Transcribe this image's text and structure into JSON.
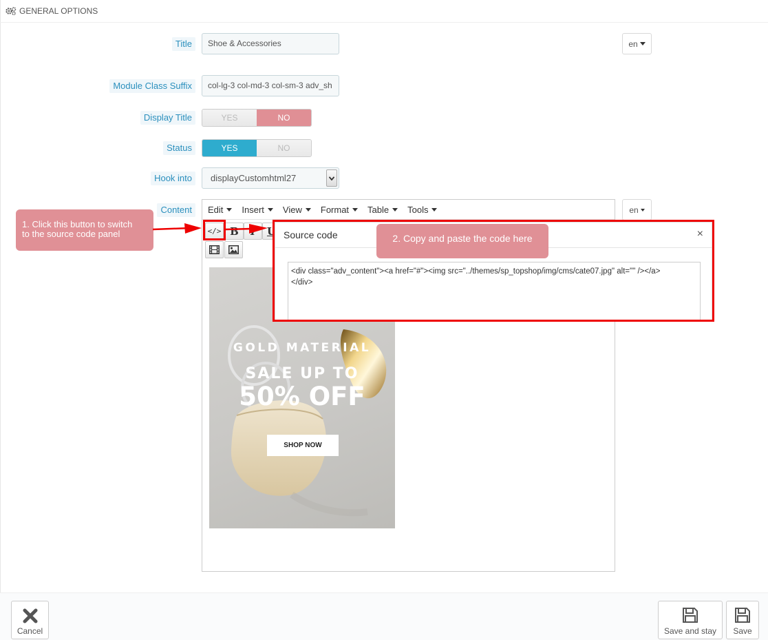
{
  "panel": {
    "heading": "GENERAL OPTIONS"
  },
  "form": {
    "title_label": "Title",
    "title_value": "Shoe & Accessories",
    "lang": "en",
    "suffix_label": "Module Class Suffix",
    "suffix_value": "col-lg-3 col-md-3 col-sm-3 adv_sh",
    "display_title_label": "Display Title",
    "status_label": "Status",
    "yes": "YES",
    "no": "NO",
    "hook_label": "Hook into",
    "hook_value": "displayCustomhtml27",
    "content_label": "Content"
  },
  "editor": {
    "menus": [
      "Edit",
      "Insert",
      "View",
      "Format",
      "Table",
      "Tools"
    ],
    "source_btn": "</>",
    "bold": "B",
    "italic": "I",
    "underline": "U"
  },
  "promo": {
    "line1": "GOLD MATERIAL",
    "line2": "SALE UP TO",
    "line3": "50% OFF",
    "button": "SHOP NOW"
  },
  "dialog": {
    "title": "Source code",
    "close": "×",
    "code_line1": "<div class=\"adv_content\"><a href=\"#\"><img src=\"../themes/sp_topshop/img/cms/cate07.jpg\" alt=\"\" /></a>",
    "code_line2": "</div>"
  },
  "callouts": {
    "step1_line1": "1. Click this button to switch",
    "step1_line2": "to the source code panel",
    "step2": "2. Copy and paste the code here"
  },
  "footer": {
    "cancel": "Cancel",
    "save_and_stay": "Save and stay",
    "save": "Save"
  },
  "colors": {
    "accent_blue": "#2eacce",
    "toggle_no": "#e08f95",
    "annotation_red": "#e00000",
    "callout": "#e09096"
  }
}
